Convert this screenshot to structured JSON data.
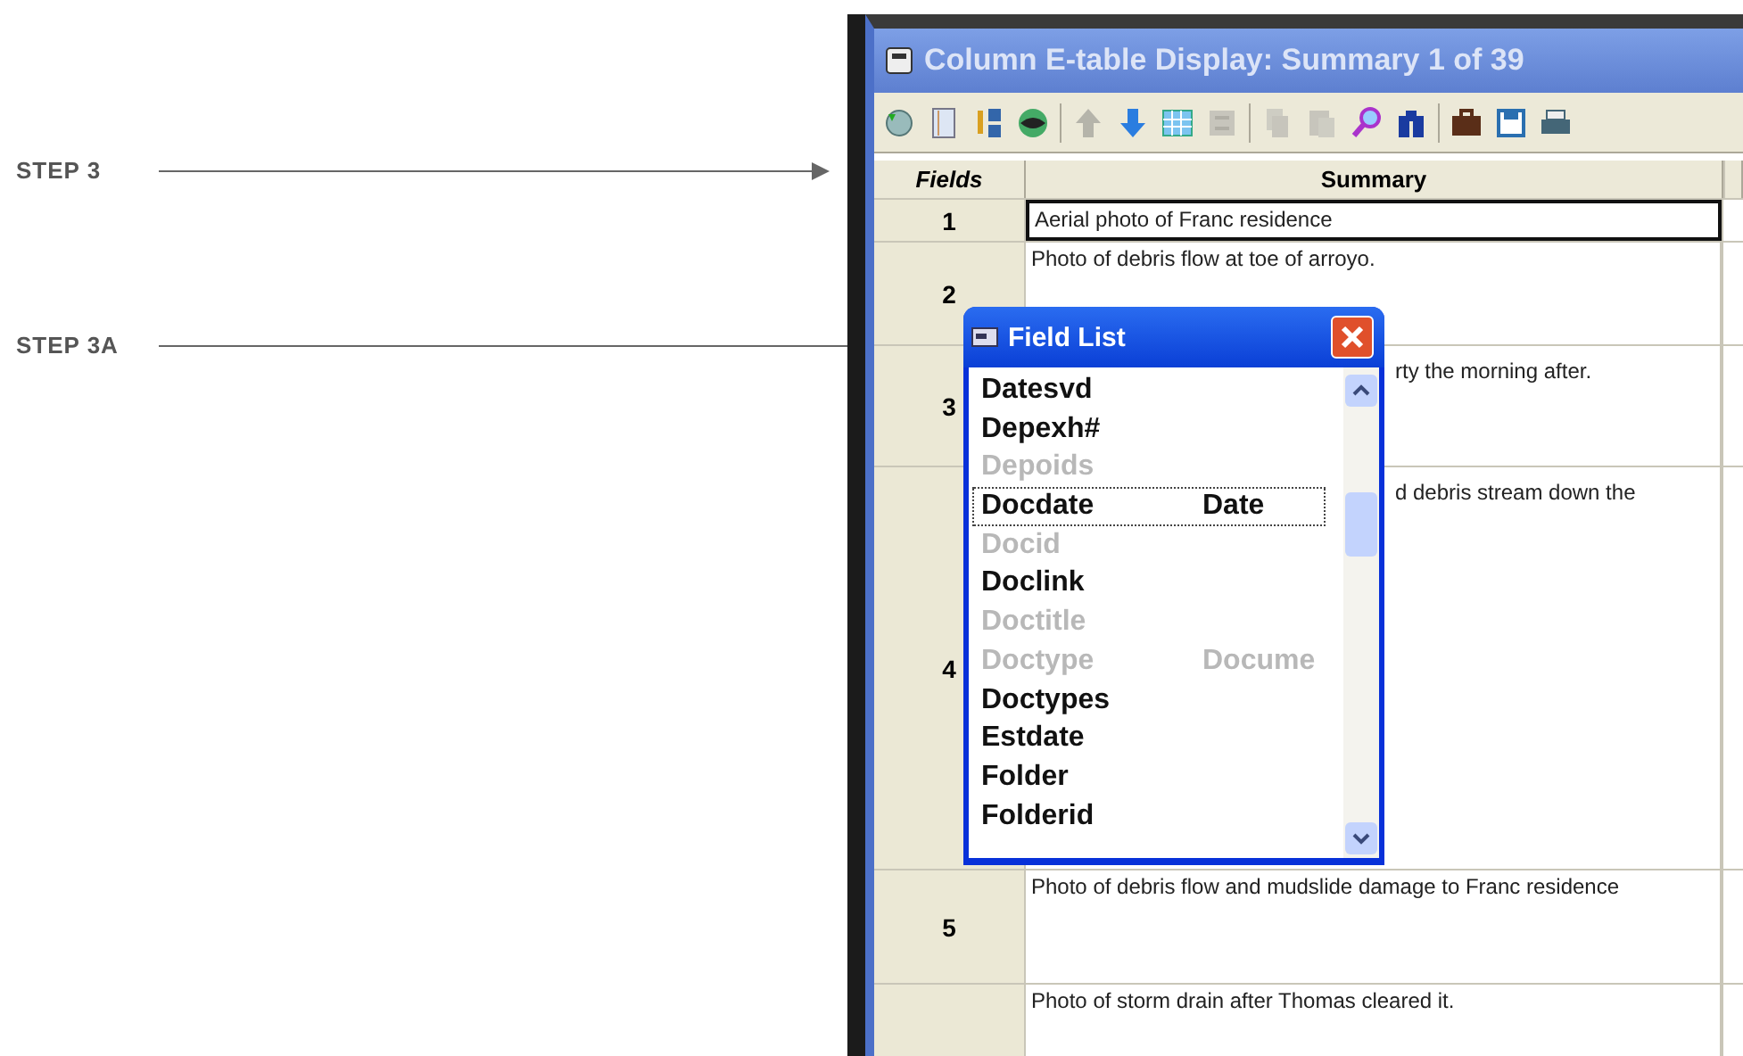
{
  "annotations": [
    {
      "label": "STEP 3"
    },
    {
      "label": "STEP 3A"
    }
  ],
  "window": {
    "title": "Column E-table Display: Summary 1 of 39"
  },
  "toolbar": [
    {
      "disabled": false
    },
    {
      "disabled": false
    },
    {
      "disabled": false
    },
    {
      "disabled": false
    },
    {
      "disabled": true
    },
    {
      "disabled": false
    },
    {
      "disabled": false
    },
    {
      "disabled": true
    },
    {
      "disabled": true
    },
    {
      "disabled": true
    },
    {
      "disabled": false
    },
    {
      "disabled": false
    },
    {
      "disabled": false
    },
    {
      "disabled": false
    },
    {
      "disabled": false
    }
  ],
  "table": {
    "columns": [
      "Fields",
      "Summary"
    ],
    "rows": [
      {
        "number": "1",
        "summary": "Aerial photo of Franc residence",
        "selected": true
      },
      {
        "number": "2",
        "summary": "Photo of debris flow at toe of arroyo.",
        "selected": false
      },
      {
        "number": "3",
        "summary": "rty the morning after.",
        "selected": false
      },
      {
        "number": "4",
        "summary": "d debris stream down the",
        "selected": false
      },
      {
        "number": "5",
        "summary": "Photo of debris flow and mudslide damage to Franc residence",
        "selected": false
      },
      {
        "summary": "Photo of storm drain after Thomas cleared it.",
        "selected": false
      }
    ]
  },
  "field_list": {
    "title": "Field List",
    "items": [
      {
        "name": "Datesvd",
        "disabled": false,
        "selected": false
      },
      {
        "name": "Depexh#",
        "disabled": false,
        "selected": false
      },
      {
        "name": "Depoids",
        "disabled": true,
        "selected": false
      },
      {
        "name": "Docdate",
        "type": "Date",
        "disabled": false,
        "selected": true
      },
      {
        "name": "Docid",
        "disabled": true,
        "selected": false
      },
      {
        "name": "Doclink",
        "disabled": false,
        "selected": false
      },
      {
        "name": "Doctitle",
        "disabled": true,
        "selected": false
      },
      {
        "name": "Doctype",
        "type": "Docume",
        "disabled": true,
        "selected": false
      },
      {
        "name": "Doctypes",
        "disabled": false,
        "selected": false
      },
      {
        "name": "Estdate",
        "disabled": false,
        "selected": false
      },
      {
        "name": "Folder",
        "disabled": false,
        "selected": false
      },
      {
        "name": "Folderid",
        "disabled": false,
        "selected": false
      }
    ]
  }
}
